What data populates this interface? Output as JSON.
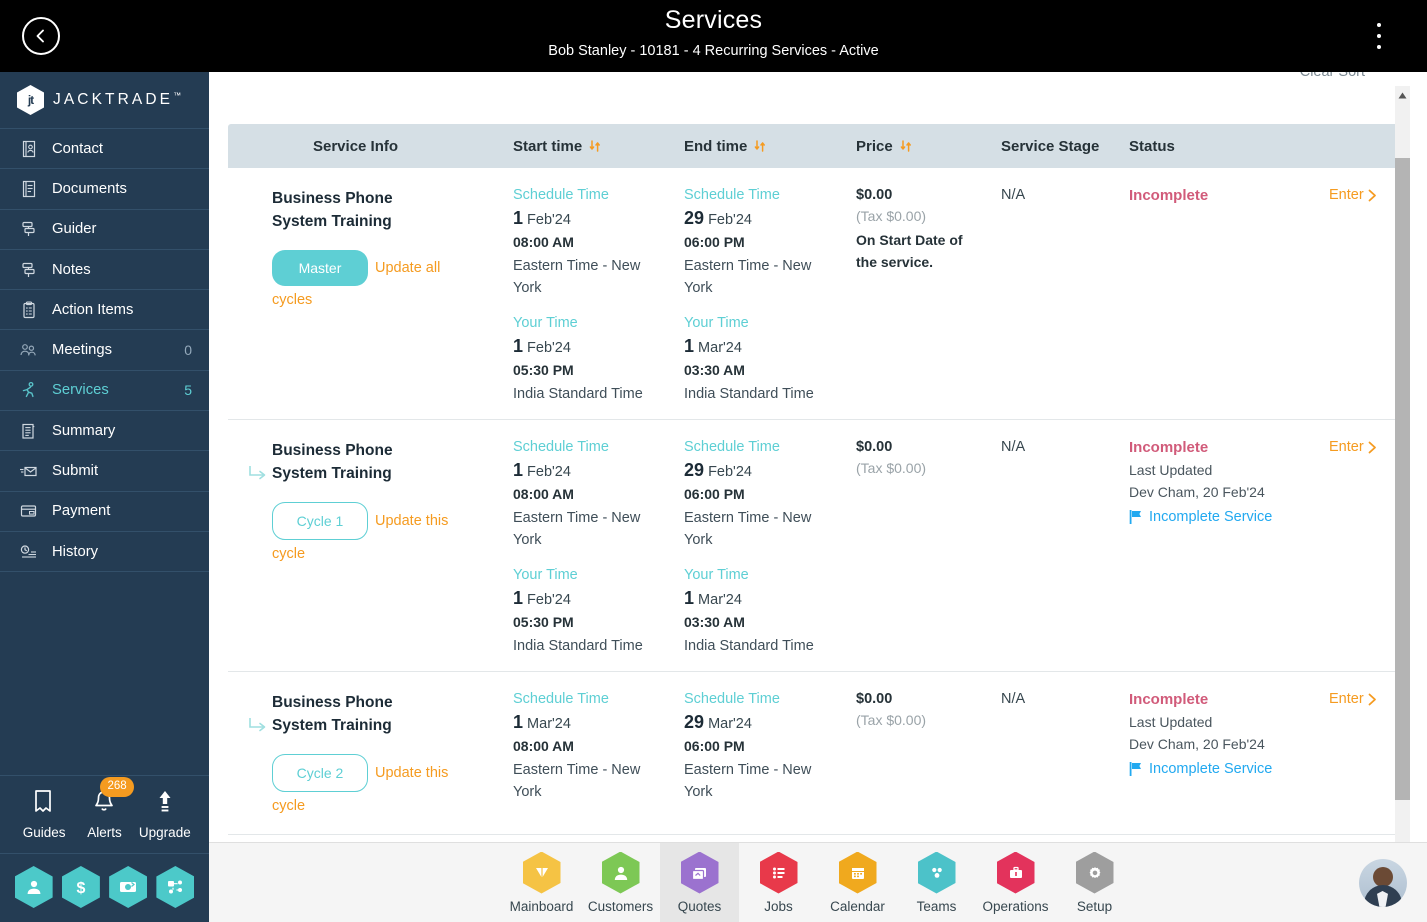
{
  "header": {
    "back_icon": "chevron-left-icon",
    "title": "Services",
    "subtitle": "Bob Stanley - 10181 - 4 Recurring Services - Active",
    "menu_icon": "kebab-menu-icon"
  },
  "sidebar": {
    "brand": "JACKTRADE",
    "brand_mark": "jt",
    "brand_tm": "™",
    "items": [
      {
        "label": "Contact",
        "icon": "contact-book-icon",
        "count": "",
        "active": false
      },
      {
        "label": "Documents",
        "icon": "documents-icon",
        "count": "",
        "active": false
      },
      {
        "label": "Guider",
        "icon": "guider-icon",
        "count": "",
        "active": false
      },
      {
        "label": "Notes",
        "icon": "notes-icon",
        "count": "",
        "active": false
      },
      {
        "label": "Action Items",
        "icon": "clipboard-icon",
        "count": "",
        "active": false
      },
      {
        "label": "Meetings",
        "icon": "meetings-icon",
        "count": "0",
        "active": false
      },
      {
        "label": "Services",
        "icon": "services-run-icon",
        "count": "5",
        "active": true
      },
      {
        "label": "Summary",
        "icon": "summary-icon",
        "count": "",
        "active": false
      },
      {
        "label": "Submit",
        "icon": "submit-mail-icon",
        "count": "",
        "active": false
      },
      {
        "label": "Payment",
        "icon": "payment-card-icon",
        "count": "",
        "active": false
      },
      {
        "label": "History",
        "icon": "history-icon",
        "count": "",
        "active": false
      }
    ],
    "tools": [
      {
        "label": "Guides",
        "icon": "book-icon",
        "badge": ""
      },
      {
        "label": "Alerts",
        "icon": "bell-icon",
        "badge": "268"
      },
      {
        "label": "Upgrade",
        "icon": "arrow-up-icon",
        "badge": ""
      }
    ],
    "hex_shortcuts": [
      {
        "icon": "user-hex-icon"
      },
      {
        "icon": "dollar-hex-icon"
      },
      {
        "icon": "money-transfer-hex-icon"
      },
      {
        "icon": "workflow-hex-icon"
      }
    ],
    "colors": {
      "bg": "#243c53",
      "accent": "#5ecfd4",
      "badge": "#f59b20"
    }
  },
  "main": {
    "clear_sort": "Clear Sort",
    "columns": [
      {
        "label": "Service Info",
        "sortable": false
      },
      {
        "label": "Start time",
        "sortable": true
      },
      {
        "label": "End time",
        "sortable": true
      },
      {
        "label": "Price",
        "sortable": true
      },
      {
        "label": "Service Stage",
        "sortable": false
      },
      {
        "label": "Status",
        "sortable": false
      },
      {
        "label": "",
        "sortable": false
      }
    ],
    "rows": [
      {
        "is_child": false,
        "title": "Business Phone System Training",
        "pill": "Master",
        "pill_type": "master",
        "update_link": "Update all cycles",
        "start": {
          "schedule_label": "Schedule Time",
          "schedule_day": "1",
          "schedule_month": "Feb'24",
          "schedule_time": "08:00 AM",
          "schedule_zone": "Eastern Time - New York",
          "your_label": "Your Time",
          "your_day": "1",
          "your_month": "Feb'24",
          "your_time": "05:30 PM",
          "your_zone": "India Standard Time"
        },
        "end": {
          "schedule_label": "Schedule Time",
          "schedule_day": "29",
          "schedule_month": "Feb'24",
          "schedule_time": "06:00 PM",
          "schedule_zone": "Eastern Time - New York",
          "your_label": "Your Time",
          "your_day": "1",
          "your_month": "Mar'24",
          "your_time": "03:30 AM",
          "your_zone": "India Standard Time"
        },
        "price": "$0.00",
        "tax": "(Tax $0.00)",
        "price_note": "On Start Date of the service.",
        "stage": "N/A",
        "status": "Incomplete",
        "last_updated_label": "",
        "last_updated_value": "",
        "flag": "",
        "enter": "Enter"
      },
      {
        "is_child": true,
        "title": "Business Phone System Training",
        "pill": "Cycle 1",
        "pill_type": "cycle",
        "update_link": "Update this cycle",
        "start": {
          "schedule_label": "Schedule Time",
          "schedule_day": "1",
          "schedule_month": "Feb'24",
          "schedule_time": "08:00 AM",
          "schedule_zone": "Eastern Time - New York",
          "your_label": "Your Time",
          "your_day": "1",
          "your_month": "Feb'24",
          "your_time": "05:30 PM",
          "your_zone": "India Standard Time"
        },
        "end": {
          "schedule_label": "Schedule Time",
          "schedule_day": "29",
          "schedule_month": "Feb'24",
          "schedule_time": "06:00 PM",
          "schedule_zone": "Eastern Time - New York",
          "your_label": "Your Time",
          "your_day": "1",
          "your_month": "Mar'24",
          "your_time": "03:30 AM",
          "your_zone": "India Standard Time"
        },
        "price": "$0.00",
        "tax": "(Tax $0.00)",
        "price_note": "",
        "stage": "N/A",
        "status": "Incomplete",
        "last_updated_label": "Last Updated",
        "last_updated_value": "Dev Cham, 20 Feb'24",
        "flag": "Incomplete Service",
        "enter": "Enter"
      },
      {
        "is_child": true,
        "title": "Business Phone System Training",
        "pill": "Cycle 2",
        "pill_type": "cycle",
        "update_link": "Update this cycle",
        "start": {
          "schedule_label": "Schedule Time",
          "schedule_day": "1",
          "schedule_month": "Mar'24",
          "schedule_time": "08:00 AM",
          "schedule_zone": "Eastern Time - New York",
          "your_label": "",
          "your_day": "",
          "your_month": "",
          "your_time": "",
          "your_zone": ""
        },
        "end": {
          "schedule_label": "Schedule Time",
          "schedule_day": "29",
          "schedule_month": "Mar'24",
          "schedule_time": "06:00 PM",
          "schedule_zone": "Eastern Time - New York",
          "your_label": "",
          "your_day": "",
          "your_month": "",
          "your_time": "",
          "your_zone": ""
        },
        "price": "$0.00",
        "tax": "(Tax $0.00)",
        "price_note": "",
        "stage": "N/A",
        "status": "Incomplete",
        "last_updated_label": "Last Updated",
        "last_updated_value": "Dev Cham, 20 Feb'24",
        "flag": "Incomplete Service",
        "enter": "Enter"
      }
    ]
  },
  "bottom_nav": {
    "items": [
      {
        "label": "Mainboard",
        "icon": "mainboard-icon",
        "color": "#f5c344",
        "active": false
      },
      {
        "label": "Customers",
        "icon": "customers-icon",
        "color": "#7dc855",
        "active": false
      },
      {
        "label": "Quotes",
        "icon": "quotes-icon",
        "color": "#9b72cf",
        "active": true
      },
      {
        "label": "Jobs",
        "icon": "jobs-icon",
        "color": "#e8394a",
        "active": false
      },
      {
        "label": "Calendar",
        "icon": "calendar-icon",
        "color": "#f0a91e",
        "active": false
      },
      {
        "label": "Teams",
        "icon": "teams-icon",
        "color": "#4cc2c9",
        "active": false
      },
      {
        "label": "Operations",
        "icon": "operations-icon",
        "color": "#e3335c",
        "active": false
      },
      {
        "label": "Setup",
        "icon": "setup-gear-icon",
        "color": "#9e9e9e",
        "active": false
      }
    ],
    "avatar": "user-avatar"
  }
}
